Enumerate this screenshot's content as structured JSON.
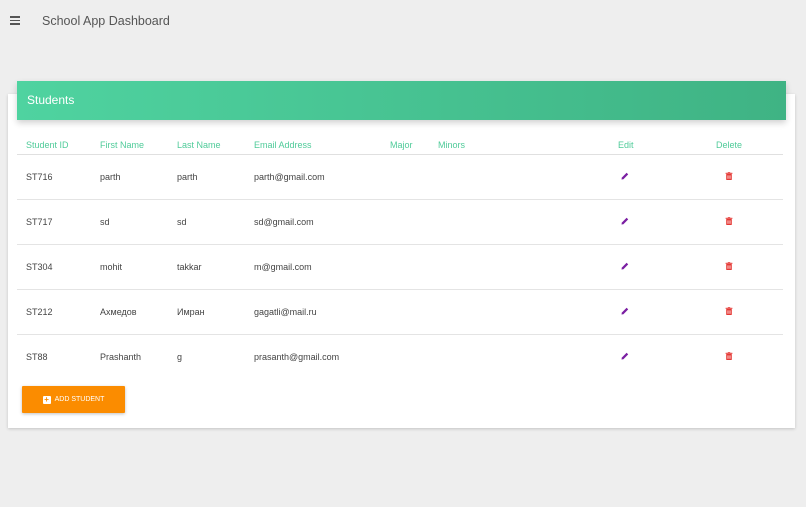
{
  "appbar": {
    "title": "School App Dashboard",
    "menu_icon": "hamburger-menu-icon"
  },
  "card": {
    "title": "Students",
    "columns": {
      "student_id": "Student ID",
      "first_name": "First Name",
      "last_name": "Last Name",
      "email": "Email Address",
      "major": "Major",
      "minors": "Minors",
      "edit": "Edit",
      "delete": "Delete"
    },
    "rows": [
      {
        "student_id": "ST716",
        "first_name": "parth",
        "last_name": "parth",
        "email": "parth@gmail.com",
        "major": "",
        "minors": ""
      },
      {
        "student_id": "ST717",
        "first_name": "sd",
        "last_name": "sd",
        "email": "sd@gmail.com",
        "major": "",
        "minors": ""
      },
      {
        "student_id": "ST304",
        "first_name": "mohit",
        "last_name": "takkar",
        "email": "m@gmail.com",
        "major": "",
        "minors": ""
      },
      {
        "student_id": "ST212",
        "first_name": "Ахмедов",
        "last_name": "Имран",
        "email": "gagatli@mail.ru",
        "major": "",
        "minors": ""
      },
      {
        "student_id": "ST88",
        "first_name": "Prashanth",
        "last_name": "g",
        "email": "prasanth@gmail.com",
        "major": "",
        "minors": ""
      }
    ],
    "edit_icon": "pencil-icon",
    "delete_icon": "trash-icon",
    "add_button_label": "ADD STUDENT",
    "add_button_icon": "plus-box-icon"
  },
  "colors": {
    "header_gradient_start": "#4fd3a0",
    "header_gradient_end": "#3fb384",
    "column_header_text": "#4fcb99",
    "edit_icon": "#7b1fa2",
    "delete_icon": "#e53935",
    "add_button": "#fb8c00"
  }
}
